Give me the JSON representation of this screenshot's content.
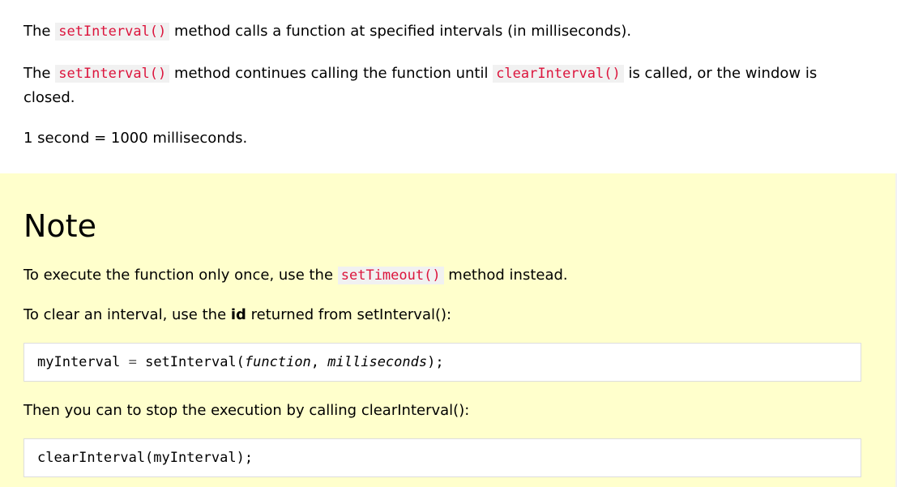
{
  "intro": {
    "p1": {
      "before": "The ",
      "code": "setInterval()",
      "after": " method calls a function at specified intervals (in milliseconds)."
    },
    "p2": {
      "before": "The ",
      "code1": "setInterval()",
      "middle": " method continues calling the function until ",
      "code2": "clearInterval()",
      "after": " is called, or the window is closed."
    },
    "p3": "1 second = 1000 milliseconds."
  },
  "note": {
    "title": "Note",
    "p1": {
      "before": "To execute the function only once, use the ",
      "code": "setTimeout()",
      "after": " method instead."
    },
    "p2": {
      "before": "To clear an interval, use the ",
      "bold": "id",
      "after": " returned from setInterval():"
    },
    "code1": {
      "var": "myInterval",
      "op": " = ",
      "call": "setInterval(",
      "arg1": "function",
      "sep": ", ",
      "arg2": "milliseconds",
      "end": ");"
    },
    "p3": "Then you can to stop the execution by calling clearInterval():",
    "code2": "clearInterval(myInterval);"
  }
}
